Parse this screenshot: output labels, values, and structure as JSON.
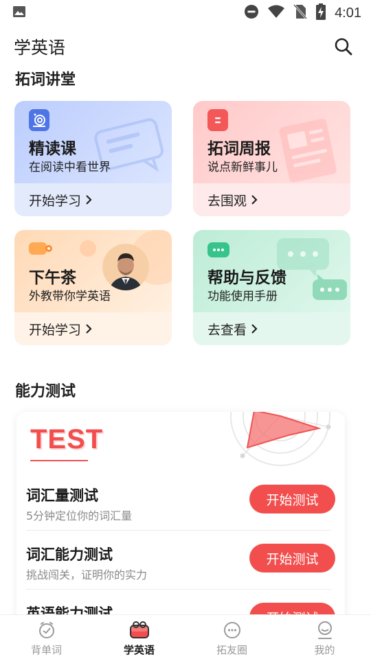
{
  "status_bar": {
    "time": "4:01",
    "icons": [
      "image-icon",
      "dnd-icon",
      "wifi-icon",
      "no-sim-icon",
      "battery-charging-icon"
    ]
  },
  "header": {
    "title": "学英语",
    "search_icon": "search-icon"
  },
  "sections": {
    "courses_title": "拓词讲堂",
    "test_title": "能力测试"
  },
  "cards": [
    {
      "title": "精读课",
      "subtitle": "在阅读中看世界",
      "action": "开始学习",
      "icon": "snail-icon"
    },
    {
      "title": "拓词周报",
      "subtitle": "说点新鲜事儿",
      "action": "去围观",
      "icon": "newspaper-icon"
    },
    {
      "title": "下午茶",
      "subtitle": "外教带你学英语",
      "action": "开始学习",
      "icon": "tea-icon"
    },
    {
      "title": "帮助与反馈",
      "subtitle": "功能使用手册",
      "action": "去查看",
      "icon": "chat-icon"
    }
  ],
  "test_card": {
    "logo_text": "TEST",
    "items": [
      {
        "title": "词汇量测试",
        "subtitle": "5分钟定位你的词汇量",
        "button": "开始测试"
      },
      {
        "title": "词汇能力测试",
        "subtitle": "挑战闯关，证明你的实力",
        "button": "开始测试"
      },
      {
        "title": "英语能力测试",
        "subtitle": "",
        "button": "开始测试"
      }
    ]
  },
  "bottom_nav": [
    {
      "label": "背单词",
      "icon": "clock-icon",
      "active": false
    },
    {
      "label": "学英语",
      "icon": "tv-icon",
      "active": true
    },
    {
      "label": "拓友圈",
      "icon": "chat-bubble-icon",
      "active": false
    },
    {
      "label": "我的",
      "icon": "profile-icon",
      "active": false
    }
  ],
  "colors": {
    "accent": "#f24e4e",
    "card_blue": "#c9d8ff",
    "card_pink": "#ffd6d6",
    "card_orange": "#ffe3c8",
    "card_green": "#cdf1e1"
  }
}
